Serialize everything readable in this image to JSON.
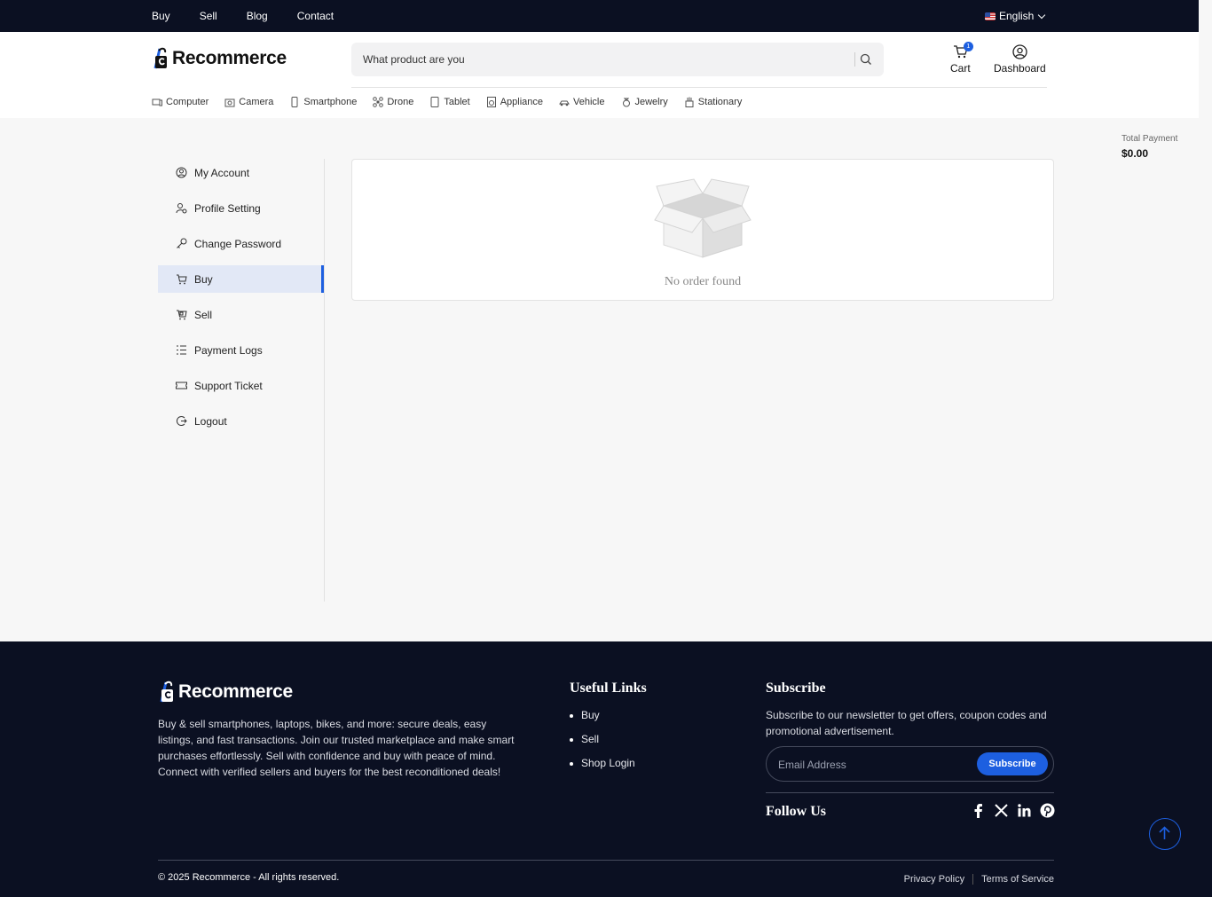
{
  "topbar": {
    "nav": [
      "Buy",
      "Sell",
      "Blog",
      "Contact"
    ],
    "language": "English"
  },
  "brand": {
    "name": "Recommerce"
  },
  "header": {
    "search_placeholder": "What product are you",
    "cart_label": "Cart",
    "cart_count": "1",
    "dashboard_label": "Dashboard"
  },
  "categories": [
    "Computer",
    "Camera",
    "Smartphone",
    "Drone",
    "Tablet",
    "Appliance",
    "Vehicle",
    "Jewelry",
    "Stationary"
  ],
  "total_payment": {
    "label": "Total Payment",
    "value": "$0.00"
  },
  "sidebar": {
    "items": [
      {
        "label": "My Account",
        "icon": "user-circle-icon"
      },
      {
        "label": "Profile Setting",
        "icon": "user-gear-icon"
      },
      {
        "label": "Change Password",
        "icon": "key-icon"
      },
      {
        "label": "Buy",
        "icon": "cart-icon",
        "active": true
      },
      {
        "label": "Sell",
        "icon": "sell-cart-icon"
      },
      {
        "label": "Payment Logs",
        "icon": "list-icon"
      },
      {
        "label": "Support Ticket",
        "icon": "ticket-icon"
      },
      {
        "label": "Logout",
        "icon": "logout-icon"
      }
    ]
  },
  "orders": {
    "empty_text": "No order found"
  },
  "footer": {
    "description": "Buy & sell smartphones, laptops, bikes, and more: secure deals, easy listings, and fast transactions. Join our trusted marketplace and make smart purchases effortlessly. Sell with confidence and buy with peace of mind. Connect with verified sellers and buyers for the best reconditioned deals!",
    "useful_links_title": "Useful Links",
    "useful_links": [
      "Buy",
      "Sell",
      "Shop Login"
    ],
    "subscribe_title": "Subscribe",
    "subscribe_text": "Subscribe to our newsletter to get offers, coupon codes and promotional advertisement.",
    "email_placeholder": "Email Address",
    "subscribe_button": "Subscribe",
    "follow_title": "Follow Us",
    "copyright": "© 2025 Recommerce - All rights reserved.",
    "privacy": "Privacy Policy",
    "terms": "Terms of Service"
  },
  "colors": {
    "accent": "#1d5fe0",
    "dark": "#0b1022"
  }
}
